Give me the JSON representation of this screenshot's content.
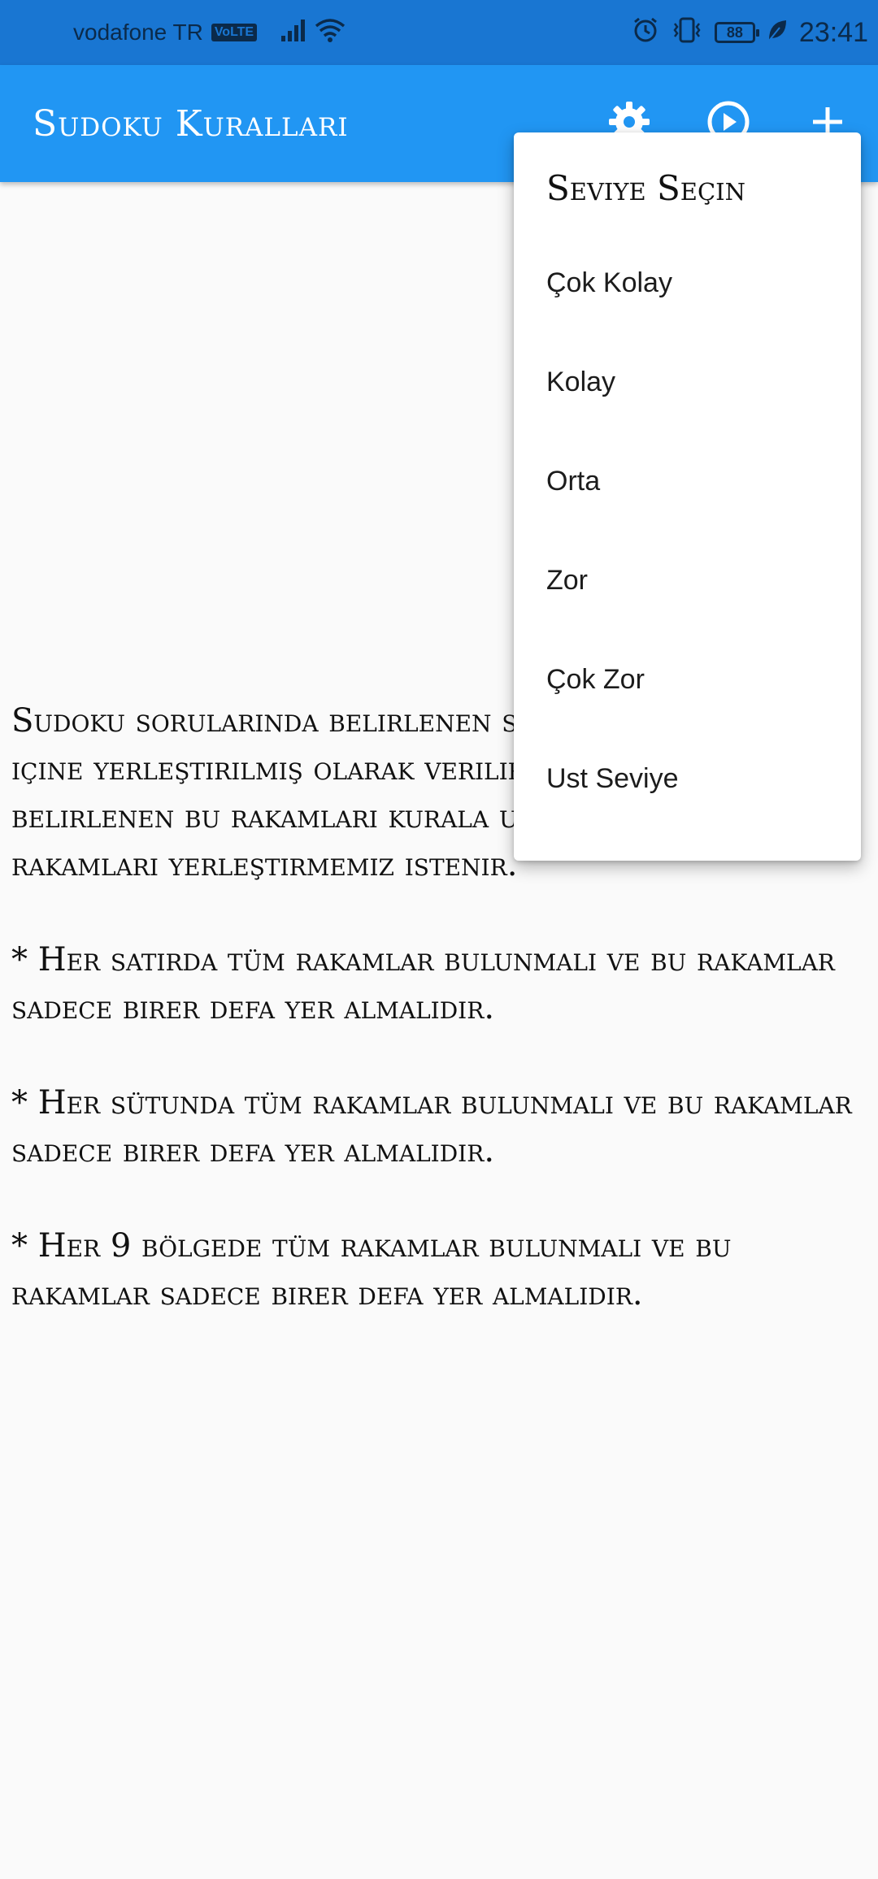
{
  "status_bar": {
    "carrier": "vodafone TR",
    "volte": "VoLTE",
    "battery": "88",
    "time": "23:41",
    "icons": [
      "signal-icon",
      "wifi-icon",
      "alarm-icon",
      "vibrate-icon",
      "battery-icon",
      "leaf-icon"
    ]
  },
  "app_bar": {
    "title": "Sudoku Kuralları",
    "color": "#2196f3",
    "actions": [
      "gear-icon",
      "play-circle-icon",
      "plus-icon"
    ]
  },
  "content": {
    "paragraphs": [
      "Sudoku sorularında belirlenen sayıda rakam sudoku içine yerleştirilmiş olarak verilir. Daha sonra belirlenen bu rakamları kurala uygun olacak şekilde rakamları yerleştirmemiz istenir.",
      "* Her satırda tüm rakamlar bulunmalı ve bu rakamlar sadece birer defa yer almalıdır.",
      "* Her sütunda tüm rakamlar bulunmalı ve bu rakamlar sadece birer defa yer almalıdır.",
      "* Her 9 bölgede tüm rakamlar bulunmalı ve bu rakamlar sadece birer defa yer almalıdır."
    ]
  },
  "level_menu": {
    "title": "Seviye Seçin",
    "items": [
      "Çok Kolay",
      "Kolay",
      "Orta",
      "Zor",
      "Çok Zor",
      "Ust Seviye"
    ]
  }
}
